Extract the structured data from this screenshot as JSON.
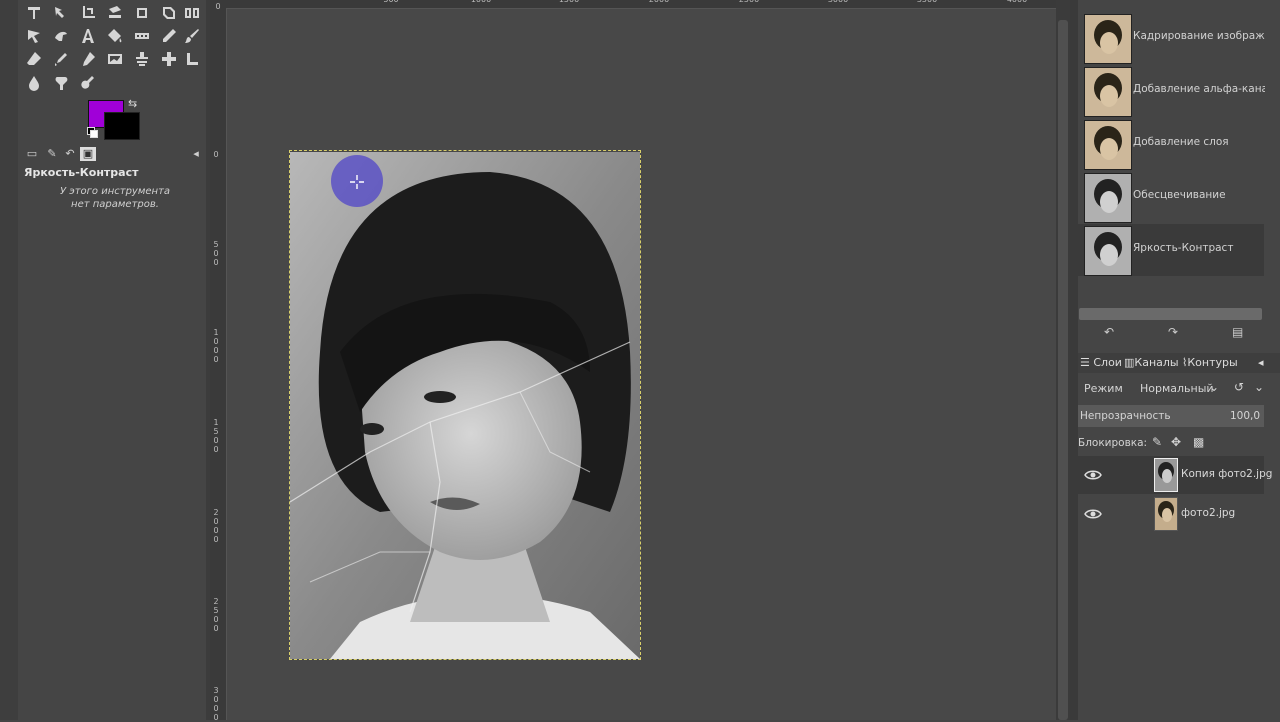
{
  "tool_options": {
    "title": "Яркость-Контраст",
    "message_line1": "У этого инструмента",
    "message_line2": "нет параметров."
  },
  "colors": {
    "foreground": "#a000d8",
    "background": "#000000",
    "brush_overlay": "#5046c8"
  },
  "ruler_top_labels": [
    "500",
    "1000",
    "1500",
    "2000",
    "2500",
    "3000",
    "3500",
    "4000"
  ],
  "ruler_left_labels": [
    "0",
    "500",
    "1000",
    "1500",
    "2000",
    "2500",
    "3000"
  ],
  "history": {
    "items": [
      {
        "label": "Кадрирование изображения"
      },
      {
        "label": "Добавление альфа-канала"
      },
      {
        "label": "Добавление слоя"
      },
      {
        "label": "Обесцвечивание"
      },
      {
        "label": "Яркость-Контраст"
      }
    ]
  },
  "dock_tabs": {
    "layers": "Слои",
    "channels": "Каналы",
    "paths": "Контуры"
  },
  "layers_panel": {
    "mode_label": "Режим",
    "mode_value": "Нормальный",
    "opacity_label": "Непрозрачность",
    "opacity_value": "100,0",
    "lock_label": "Блокировка:",
    "layers": [
      {
        "name": "Копия фото2.jpg"
      },
      {
        "name": "фото2.jpg"
      }
    ]
  }
}
